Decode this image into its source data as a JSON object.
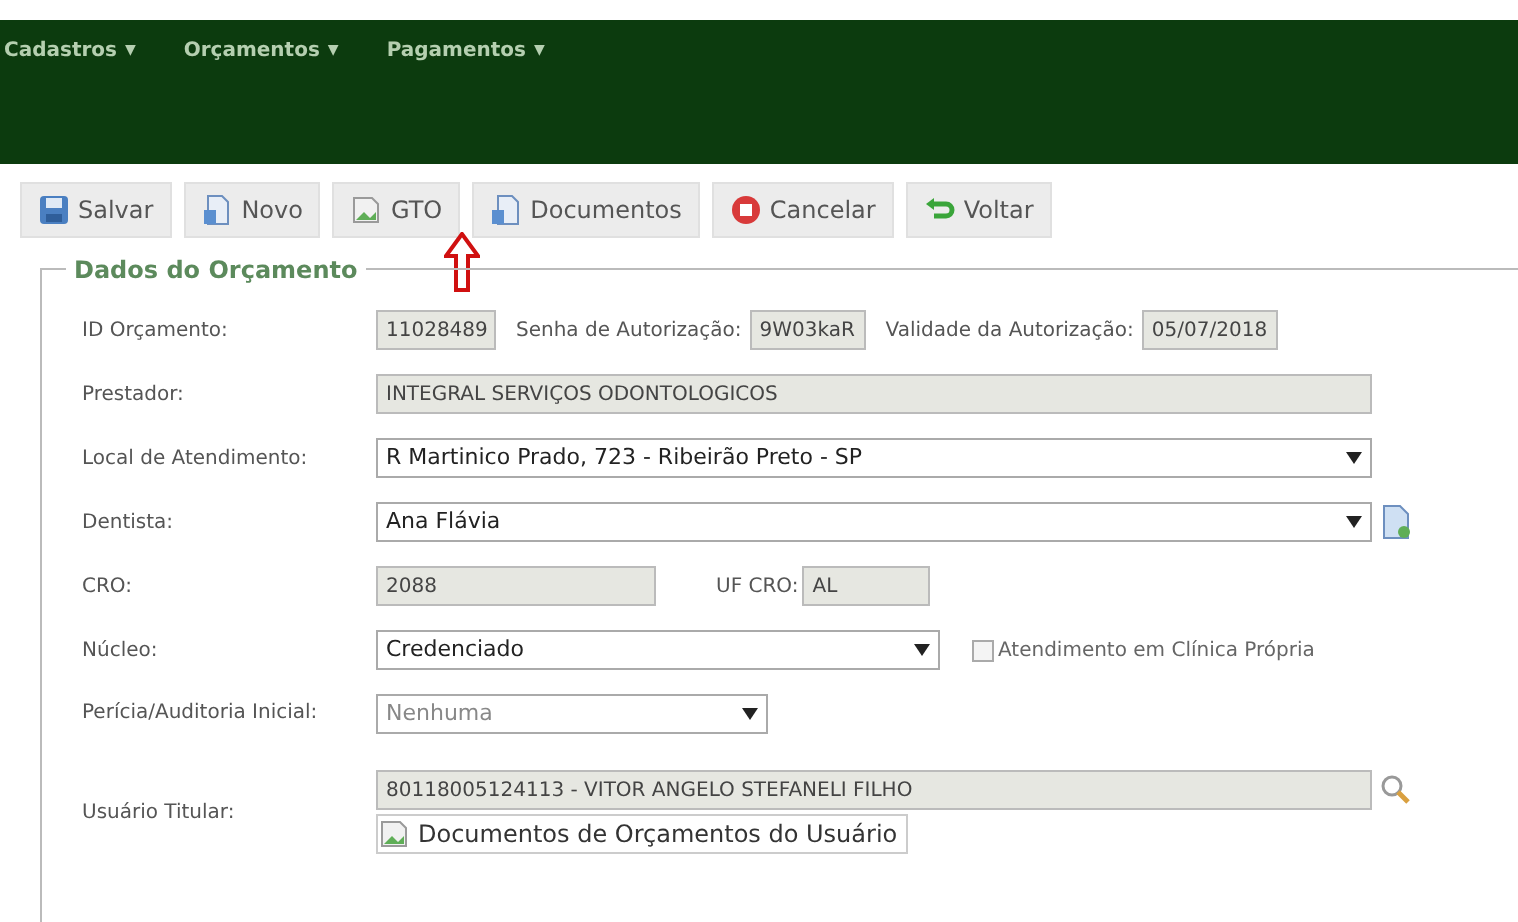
{
  "menu": [
    {
      "label": "Cadastros",
      "caret": "▼"
    },
    {
      "label": "Orçamentos",
      "caret": "▼"
    },
    {
      "label": "Pagamentos",
      "caret": "▼"
    }
  ],
  "toolbar": [
    {
      "label": "Salvar",
      "kind": "save"
    },
    {
      "label": "Novo",
      "kind": "new"
    },
    {
      "label": "GTO",
      "kind": "broken"
    },
    {
      "label": "Documentos",
      "kind": "docs"
    },
    {
      "label": "Cancelar",
      "kind": "cancel"
    },
    {
      "label": "Voltar",
      "kind": "back"
    }
  ],
  "legend": "Dados do Orçamento",
  "id_row": {
    "id_label": "ID Orçamento:",
    "id_value": "11028489",
    "senha_label": "Senha de Autorização:",
    "senha_value": "9W03kaR",
    "validade_label": "Validade da Autorização:",
    "validade_value": "05/07/2018"
  },
  "prestador": {
    "label": "Prestador:",
    "value": "INTEGRAL SERVIÇOS ODONTOLOGICOS"
  },
  "local": {
    "label": "Local de Atendimento:",
    "value": "R Martinico Prado, 723 - Ribeirão Preto - SP"
  },
  "dentista": {
    "label": "Dentista:",
    "value": "Ana Flávia"
  },
  "cro": {
    "label": "CRO:",
    "value": "2088",
    "uf_label": "UF CRO:",
    "uf_value": "AL"
  },
  "nucleo": {
    "label": "Núcleo:",
    "value": "Credenciado",
    "checkbox_label": "Atendimento em Clínica Própria",
    "checked": false
  },
  "pericia": {
    "label": "Perícia/Auditoria Inicial:",
    "value": "Nenhuma"
  },
  "usuario": {
    "label": "Usuário Titular:",
    "value": "80118005124113 - VITOR ANGELO STEFANELI FILHO",
    "docs_alt": "Documentos de Orçamentos do Usuário"
  }
}
